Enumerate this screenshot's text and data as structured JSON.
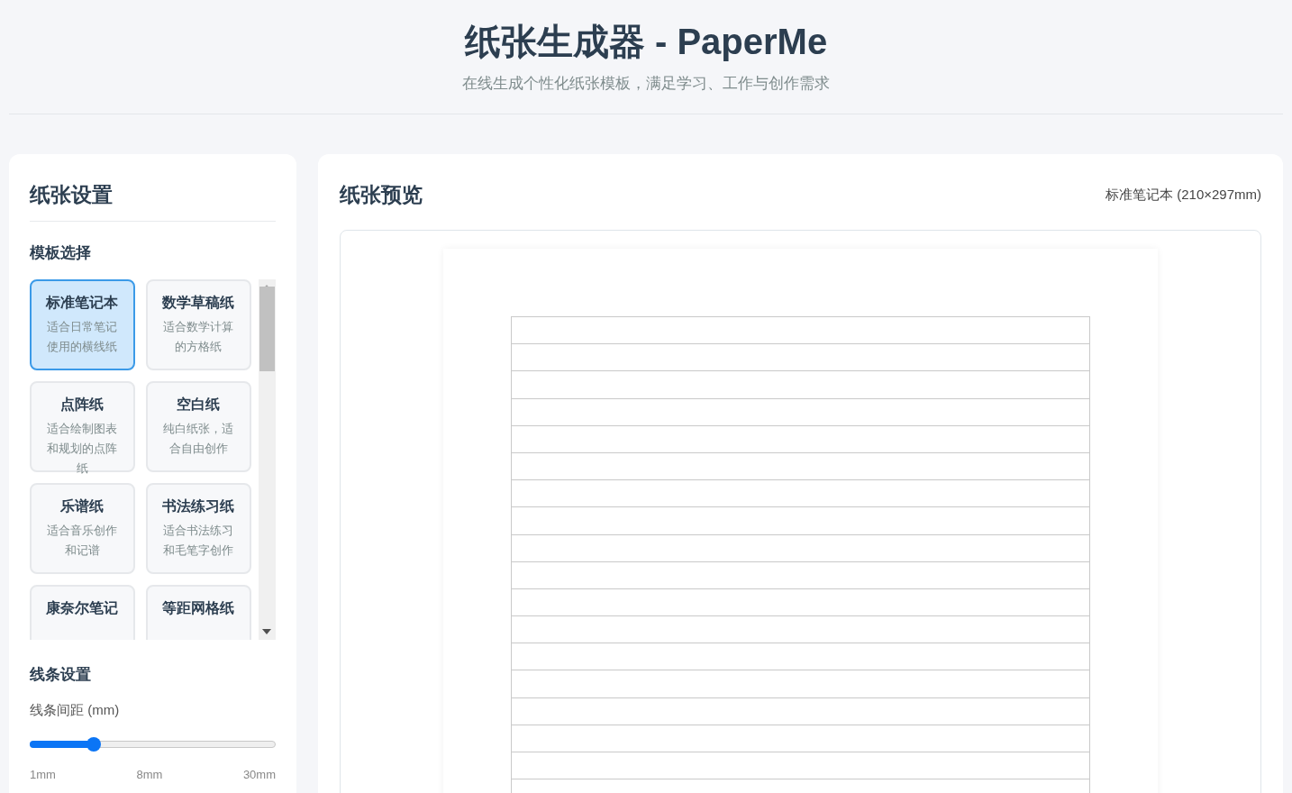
{
  "header": {
    "title": "纸张生成器 - PaperMe",
    "subtitle": "在线生成个性化纸张模板，满足学习、工作与创作需求"
  },
  "settings": {
    "title": "纸张设置",
    "template_section": "模板选择",
    "templates": [
      {
        "name": "标准笔记本",
        "description": "适合日常笔记使用的横线纸",
        "selected": true
      },
      {
        "name": "数学草稿纸",
        "description": "适合数学计算的方格纸",
        "selected": false
      },
      {
        "name": "点阵纸",
        "description": "适合绘制图表和规划的点阵纸",
        "selected": false
      },
      {
        "name": "空白纸",
        "description": "纯白纸张，适合自由创作",
        "selected": false
      },
      {
        "name": "乐谱纸",
        "description": "适合音乐创作和记谱",
        "selected": false
      },
      {
        "name": "书法练习纸",
        "description": "适合书法练习和毛笔字创作",
        "selected": false
      },
      {
        "name": "康奈尔笔记",
        "selected": false
      },
      {
        "name": "等距网格纸",
        "selected": false
      }
    ],
    "line_section": "线条设置",
    "spacing_label": "线条间距 (mm)",
    "spacing": {
      "level": 0.26
    },
    "ticks": [
      "1mm",
      "8mm",
      "30mm"
    ]
  },
  "preview": {
    "title": "纸张预览",
    "info": "标准笔记本 (210×297mm)"
  }
}
